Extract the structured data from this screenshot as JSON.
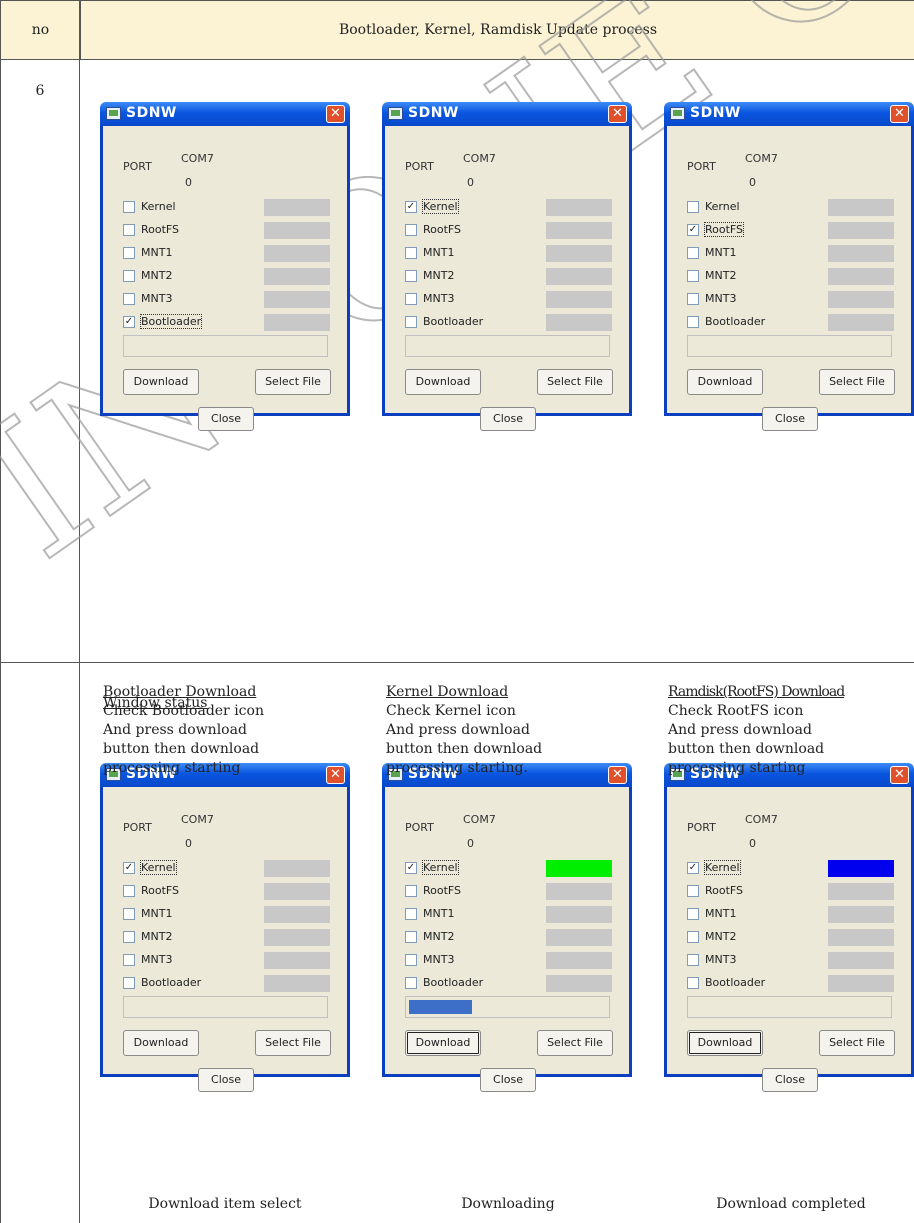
{
  "header": {
    "no": "no",
    "title": "Bootloader, Kernel, Ramdisk Update process"
  },
  "row1": {
    "no": "6"
  },
  "window_common": {
    "title": "SDNW",
    "port_label": "PORT",
    "port_value": "COM7",
    "counter": "0",
    "items": [
      "Kernel",
      "RootFS",
      "MNT1",
      "MNT2",
      "MNT3",
      "Bootloader"
    ],
    "download_label": "Download",
    "select_file_label": "Select File",
    "close_label": "Close",
    "close_glyph": "✕",
    "check_glyph": "✓"
  },
  "bar_colors": {
    "idle": "#c8c8c8",
    "downloading": "#00ee00",
    "completed": "#0000ee",
    "progress": "#3d6fc8"
  },
  "windows": [
    {
      "checked": [
        false,
        false,
        false,
        false,
        false,
        true
      ],
      "bars": [
        "idle",
        "idle",
        "idle",
        "idle",
        "idle",
        "idle"
      ],
      "progress": 0,
      "pressed": false
    },
    {
      "checked": [
        true,
        false,
        false,
        false,
        false,
        false
      ],
      "bars": [
        "idle",
        "idle",
        "idle",
        "idle",
        "idle",
        "idle"
      ],
      "progress": 0,
      "pressed": false
    },
    {
      "checked": [
        false,
        true,
        false,
        false,
        false,
        false
      ],
      "bars": [
        "idle",
        "idle",
        "idle",
        "idle",
        "idle",
        "idle"
      ],
      "progress": 0,
      "pressed": false
    },
    {
      "checked": [
        true,
        false,
        false,
        false,
        false,
        false
      ],
      "bars": [
        "idle",
        "idle",
        "idle",
        "idle",
        "idle",
        "idle"
      ],
      "progress": 0,
      "pressed": false
    },
    {
      "checked": [
        true,
        false,
        false,
        false,
        false,
        false
      ],
      "bars": [
        "downloading",
        "idle",
        "idle",
        "idle",
        "idle",
        "idle"
      ],
      "progress": 0.32,
      "pressed": true
    },
    {
      "checked": [
        true,
        false,
        false,
        false,
        false,
        false
      ],
      "bars": [
        "completed",
        "idle",
        "idle",
        "idle",
        "idle",
        "idle"
      ],
      "progress": 0,
      "pressed": true
    }
  ],
  "descriptions": [
    {
      "title": "Bootloader Download",
      "lines": [
        "Check Bootloader icon",
        "And press download",
        "button then download",
        "processing starting"
      ]
    },
    {
      "title": "Kernel Download",
      "lines": [
        "Check Kernel icon",
        "And press download",
        "button then download",
        "processing starting."
      ]
    },
    {
      "title": "Ramdisk(RootFS) Download",
      "lines": [
        "Check RootFS icon",
        "And press download",
        "button then download",
        "processing starting"
      ]
    }
  ],
  "window_status": {
    "title": "Window status"
  },
  "captions": [
    "Download item select",
    "Downloading",
    "Download completed"
  ]
}
